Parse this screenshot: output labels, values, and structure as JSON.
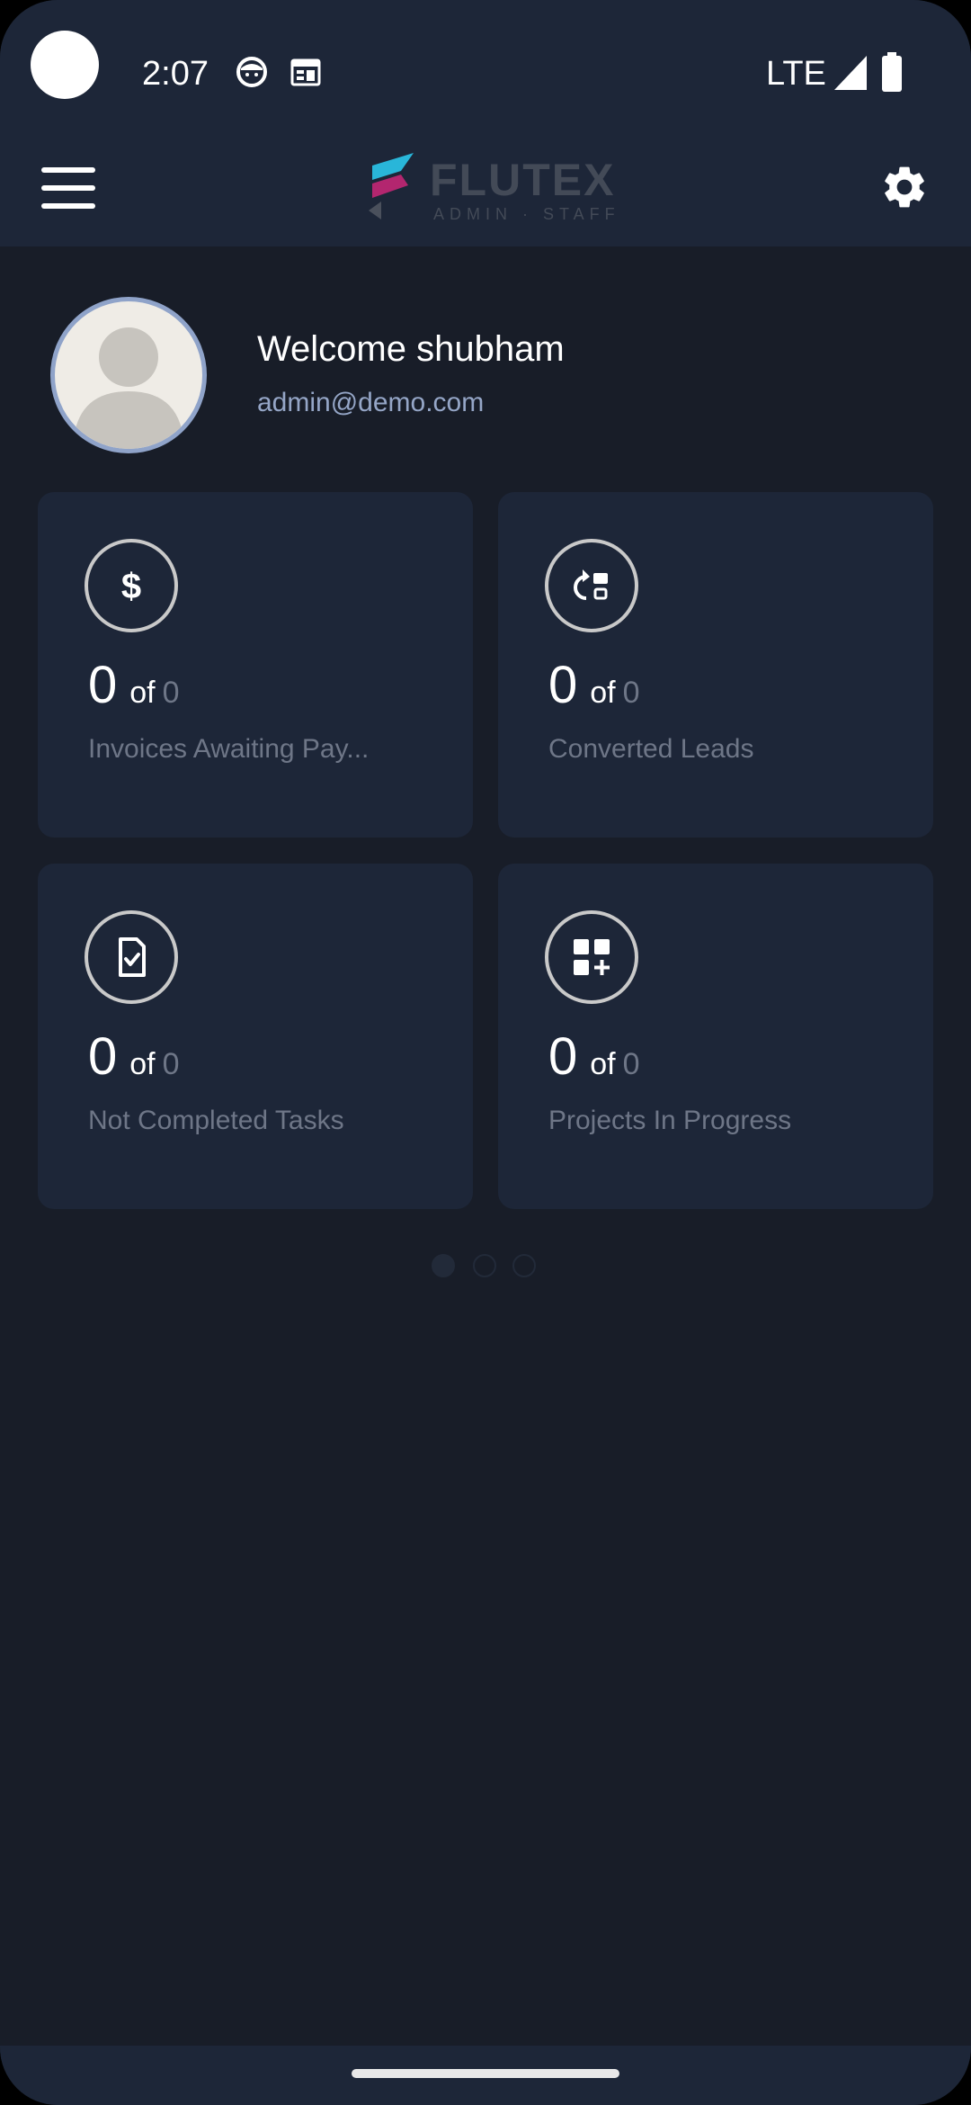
{
  "status_bar": {
    "time": "2:07",
    "network": "LTE",
    "icons": [
      "face-icon",
      "calendar-notification-icon",
      "signal-icon",
      "battery-icon"
    ]
  },
  "app_bar": {
    "logo_text": "FLUTEX",
    "logo_subtitle": "ADMIN · STAFF",
    "icons": [
      "menu-icon",
      "settings-icon"
    ]
  },
  "profile": {
    "welcome": "Welcome shubham",
    "email": "admin@demo.com"
  },
  "cards": [
    {
      "icon": "dollar-icon",
      "count": "0",
      "of": "of",
      "total": "0",
      "label": "Invoices Awaiting Pay..."
    },
    {
      "icon": "converted-leads-icon",
      "count": "0",
      "of": "of",
      "total": "0",
      "label": "Converted Leads"
    },
    {
      "icon": "task-file-check-icon",
      "count": "0",
      "of": "of",
      "total": "0",
      "label": "Not Completed Tasks"
    },
    {
      "icon": "projects-grid-plus-icon",
      "count": "0",
      "of": "of",
      "total": "0",
      "label": "Projects In Progress"
    }
  ],
  "pager": {
    "pages": 3,
    "active": 1
  },
  "colors": {
    "background": "#181d28",
    "surface": "#1d2638",
    "muted_text": "#6e7687",
    "email_text": "#95a6c7",
    "logo_cyan": "#29b6d9",
    "logo_magenta": "#b3266f"
  }
}
